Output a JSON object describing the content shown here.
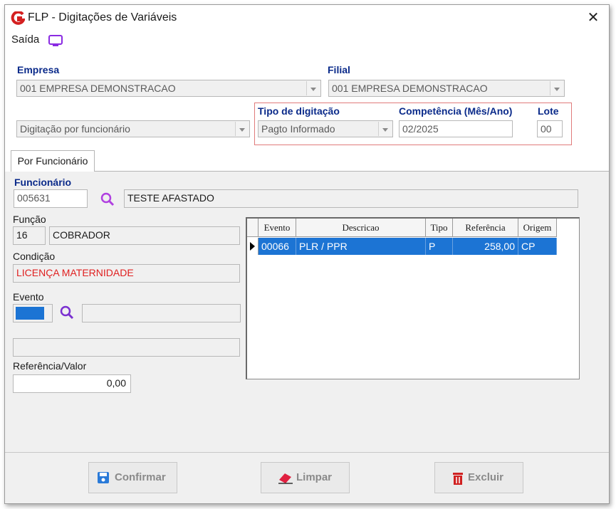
{
  "window": {
    "title": "FLP - Digitações de Variáveis",
    "close_glyph": "✕"
  },
  "menu": {
    "saida_label": "Saída"
  },
  "empresa": {
    "label": "Empresa",
    "value": "001 EMPRESA DEMONSTRACAO"
  },
  "filial": {
    "label": "Filial",
    "value": "001 EMPRESA DEMONSTRACAO"
  },
  "digitacao_mode": {
    "value": "Digitação por funcionário"
  },
  "tipo_digitacao": {
    "label": "Tipo de digitação",
    "value": "Pagto Informado"
  },
  "competencia": {
    "label": "Competência (Mês/Ano)",
    "value": "02/2025"
  },
  "lote": {
    "label": "Lote",
    "value": "00"
  },
  "tabs": [
    {
      "label": "Por Funcionário"
    }
  ],
  "funcionario": {
    "label": "Funcionário",
    "code": "005631",
    "name": "TESTE AFASTADO"
  },
  "funcao": {
    "label": "Função",
    "code": "16",
    "name": "COBRADOR"
  },
  "condicao": {
    "label": "Condição",
    "value": "LICENÇA MATERNIDADE"
  },
  "evento": {
    "label": "Evento",
    "code": "",
    "description": "",
    "extra": ""
  },
  "referencia_valor": {
    "label": "Referência/Valor",
    "value": "0,00"
  },
  "grid": {
    "columns": [
      "Evento",
      "Descricao",
      "Tipo",
      "Referência",
      "Origem"
    ],
    "rows": [
      {
        "evento": "00066",
        "descricao": "PLR / PPR",
        "tipo": "P",
        "referencia": "258,00",
        "origem": "CP"
      }
    ]
  },
  "buttons": {
    "confirmar": "Confirmar",
    "limpar": "Limpar",
    "excluir": "Excluir"
  },
  "colors": {
    "accent_blue": "#0a2a8a",
    "selection": "#1c74d4",
    "alert_red": "#e02020",
    "highlight_border": "#e07b7b",
    "icon_purple": "#8a2be2"
  }
}
